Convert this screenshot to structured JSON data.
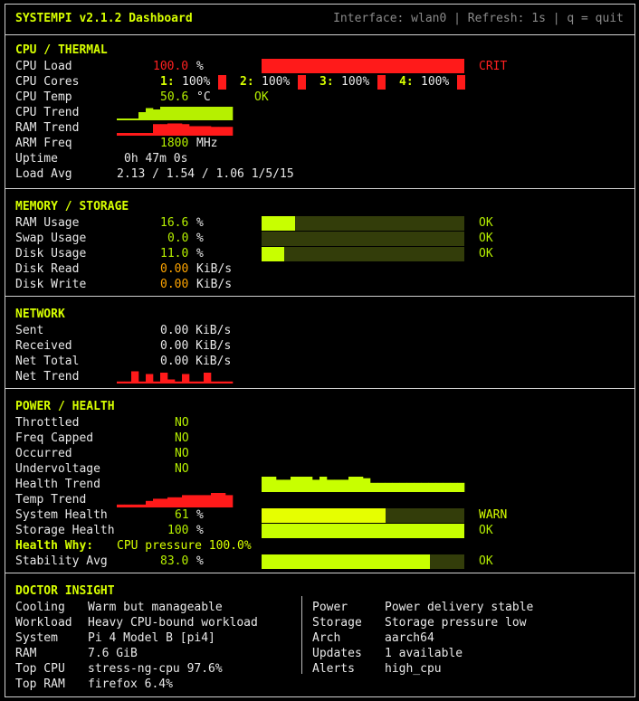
{
  "header": {
    "title": "SYSTEMPI v2.1.2 Dashboard",
    "info": "Interface: wlan0 | Refresh: 1s | q = quit"
  },
  "colors": {
    "accent": "#d7ff00",
    "ok": "#b6f000",
    "crit": "#ff1a1a",
    "warn_io": "#ffa500",
    "bar_bg": "#333d0a"
  },
  "cpu": {
    "heading": "CPU / THERMAL",
    "load": {
      "label": "CPU Load",
      "value": "100.0",
      "unit": "%",
      "percent": 100,
      "status": "CRIT"
    },
    "cores": {
      "label": "CPU Cores",
      "items": [
        {
          "id": "1:",
          "value": "100%",
          "percent": 100
        },
        {
          "id": "2:",
          "value": "100%",
          "percent": 100
        },
        {
          "id": "3:",
          "value": "100%",
          "percent": 100
        },
        {
          "id": "4:",
          "value": "100%",
          "percent": 100
        }
      ]
    },
    "temp": {
      "label": "CPU Temp",
      "value": "50.6",
      "unit": "°C",
      "status": "OK"
    },
    "cpu_trend": {
      "label": "CPU Trend",
      "values": [
        10,
        10,
        10,
        60,
        90,
        80,
        100,
        100,
        100,
        100,
        100,
        100,
        100,
        100,
        100,
        100
      ]
    },
    "ram_trend": {
      "label": "RAM Trend",
      "values": [
        20,
        20,
        20,
        20,
        20,
        85,
        85,
        90,
        90,
        85,
        70,
        70,
        70,
        65,
        65,
        65
      ]
    },
    "arm_freq": {
      "label": "ARM Freq",
      "value": "1800",
      "unit": "MHz"
    },
    "uptime": {
      "label": "Uptime",
      "value": "0h 47m 0s"
    },
    "load_avg": {
      "label": "Load Avg",
      "value": "2.13 / 1.54 / 1.06 1/5/15"
    }
  },
  "memory": {
    "heading": "MEMORY / STORAGE",
    "rows": [
      {
        "label": "RAM Usage",
        "value": "16.6",
        "unit": "%",
        "percent": 16.6,
        "status": "OK"
      },
      {
        "label": "Swap Usage",
        "value": "0.0",
        "unit": "%",
        "percent": 0,
        "status": "OK"
      },
      {
        "label": "Disk Usage",
        "value": "11.0",
        "unit": "%",
        "percent": 11,
        "status": "OK"
      }
    ],
    "disk_read": {
      "label": "Disk Read",
      "value": "0.00",
      "unit": "KiB/s"
    },
    "disk_write": {
      "label": "Disk Write",
      "value": "0.00",
      "unit": "KiB/s"
    }
  },
  "network": {
    "heading": "NETWORK",
    "sent": {
      "label": "Sent",
      "value": "0.00 KiB/s"
    },
    "received": {
      "label": "Received",
      "value": "0.00 KiB/s"
    },
    "total": {
      "label": "Net Total",
      "value": "0.00 KiB/s"
    },
    "trend": {
      "label": "Net Trend",
      "values": [
        15,
        15,
        90,
        15,
        70,
        15,
        80,
        30,
        15,
        70,
        15,
        15,
        80,
        15,
        15,
        15
      ]
    }
  },
  "power": {
    "heading": "POWER / HEALTH",
    "flags": [
      {
        "label": "Throttled",
        "value": "NO"
      },
      {
        "label": "Freq Capped",
        "value": "NO"
      },
      {
        "label": "Occurred",
        "value": "NO"
      },
      {
        "label": "Undervoltage",
        "value": "NO"
      }
    ],
    "health_trend": {
      "label": "Health Trend",
      "values": [
        100,
        100,
        80,
        80,
        100,
        100,
        100,
        80,
        100,
        80,
        80,
        80,
        100,
        100,
        90,
        60,
        60,
        60,
        60,
        60,
        60,
        60,
        60,
        60,
        60,
        60,
        60,
        60
      ]
    },
    "temp_trend": {
      "label": "Temp Trend",
      "values": [
        20,
        20,
        20,
        20,
        45,
        60,
        60,
        70,
        70,
        85,
        85,
        85,
        85,
        100,
        100,
        85
      ]
    },
    "system_health": {
      "label": "System Health",
      "value": "61",
      "unit": "%",
      "percent": 61,
      "status": "WARN"
    },
    "storage_health": {
      "label": "Storage Health",
      "value": "100",
      "unit": "%",
      "percent": 100,
      "status": "OK"
    },
    "health_why": {
      "label": "Health Why:",
      "value": "CPU pressure 100.0%"
    },
    "stability": {
      "label": "Stability Avg",
      "value": "83.0",
      "unit": "%",
      "percent": 83,
      "status": "OK"
    }
  },
  "doctor": {
    "heading": "DOCTOR INSIGHT",
    "left": [
      {
        "key": "Cooling",
        "value": "Warm but manageable"
      },
      {
        "key": "Workload",
        "value": "Heavy CPU-bound workload"
      },
      {
        "key": "System",
        "value": "Pi 4 Model B [pi4]"
      },
      {
        "key": "RAM",
        "value": "7.6 GiB"
      },
      {
        "key": "Top CPU",
        "value": "stress-ng-cpu 97.6%"
      },
      {
        "key": "Top RAM",
        "value": "firefox 6.4%"
      }
    ],
    "right": [
      {
        "key": "Power",
        "value": "Power delivery stable"
      },
      {
        "key": "Storage",
        "value": "Storage pressure low"
      },
      {
        "key": "Arch",
        "value": "aarch64"
      },
      {
        "key": "Updates",
        "value": "1 available"
      },
      {
        "key": "Alerts",
        "value": "high_cpu"
      }
    ]
  }
}
